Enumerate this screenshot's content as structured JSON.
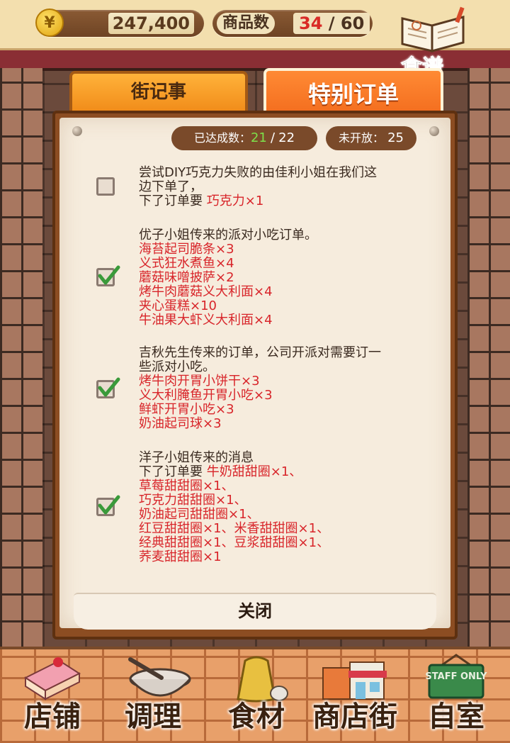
{
  "header": {
    "money": "247,400",
    "coin_symbol": "¥",
    "goods_label": "商品数",
    "goods_current": "34",
    "goods_sep": "/",
    "goods_max": "60",
    "recipe_label": "食谱"
  },
  "tabs": [
    {
      "label": "街记事",
      "active": false
    },
    {
      "label": "特别订单",
      "active": true
    }
  ],
  "stats": {
    "achieved_label": "已达成数：",
    "achieved": "21",
    "achieved_sep": "/",
    "achieved_total": "22",
    "locked_label": "未开放：",
    "locked": "25"
  },
  "orders": [
    {
      "checked": false,
      "desc": [
        "尝试DIY巧克力失败的由佳利小姐在我们这",
        "边下单了，"
      ],
      "prefix": "下了订单要 ",
      "inline_item": "巧克力×1",
      "items": []
    },
    {
      "checked": true,
      "desc": [
        "优子小姐传来的派对小吃订单。"
      ],
      "prefix": "",
      "inline_item": "",
      "items": [
        "海苔起司脆条×3",
        "义式狂水煮鱼×4",
        "蘑菇味噌披萨×2",
        "烤牛肉蘑菇义大利面×4",
        "夹心蛋糕×10",
        "牛油果大虾义大利面×4"
      ]
    },
    {
      "checked": true,
      "desc": [
        "吉秋先生传来的订单，公司开派对需要订一",
        "些派对小吃。"
      ],
      "prefix": "",
      "inline_item": "",
      "items": [
        "烤牛肉开胃小饼干×3",
        "义大利腌鱼开胃小吃×3",
        "鲜虾开胃小吃×3",
        "奶油起司球×3"
      ]
    },
    {
      "checked": true,
      "desc": [
        "洋子小姐传来的消息"
      ],
      "prefix": "下了订单要 ",
      "inline_item": "牛奶甜甜圈×1、",
      "items": [
        "草莓甜甜圈×1、",
        "巧克力甜甜圈×1、",
        "奶油起司甜甜圈×1、",
        "红豆甜甜圈×1、米香甜甜圈×1、",
        "经典甜甜圈×1、豆浆甜甜圈×1、",
        "荞麦甜甜圈×1"
      ]
    }
  ],
  "close_label": "关闭",
  "nav": [
    {
      "label": "店铺",
      "icon": "cake-icon"
    },
    {
      "label": "调理",
      "icon": "mixing-bowl-icon"
    },
    {
      "label": "食材",
      "icon": "ingredient-bag-icon"
    },
    {
      "label": "商店街",
      "icon": "storefront-icon"
    },
    {
      "label": "自室",
      "icon": "staff-only-door-icon"
    }
  ],
  "staff_sign": "STAFF ONLY",
  "colors": {
    "accent": "#f26a1c",
    "item_red": "#d8252a",
    "achieved_green": "#7ee04a",
    "current_red": "#d92a26"
  }
}
